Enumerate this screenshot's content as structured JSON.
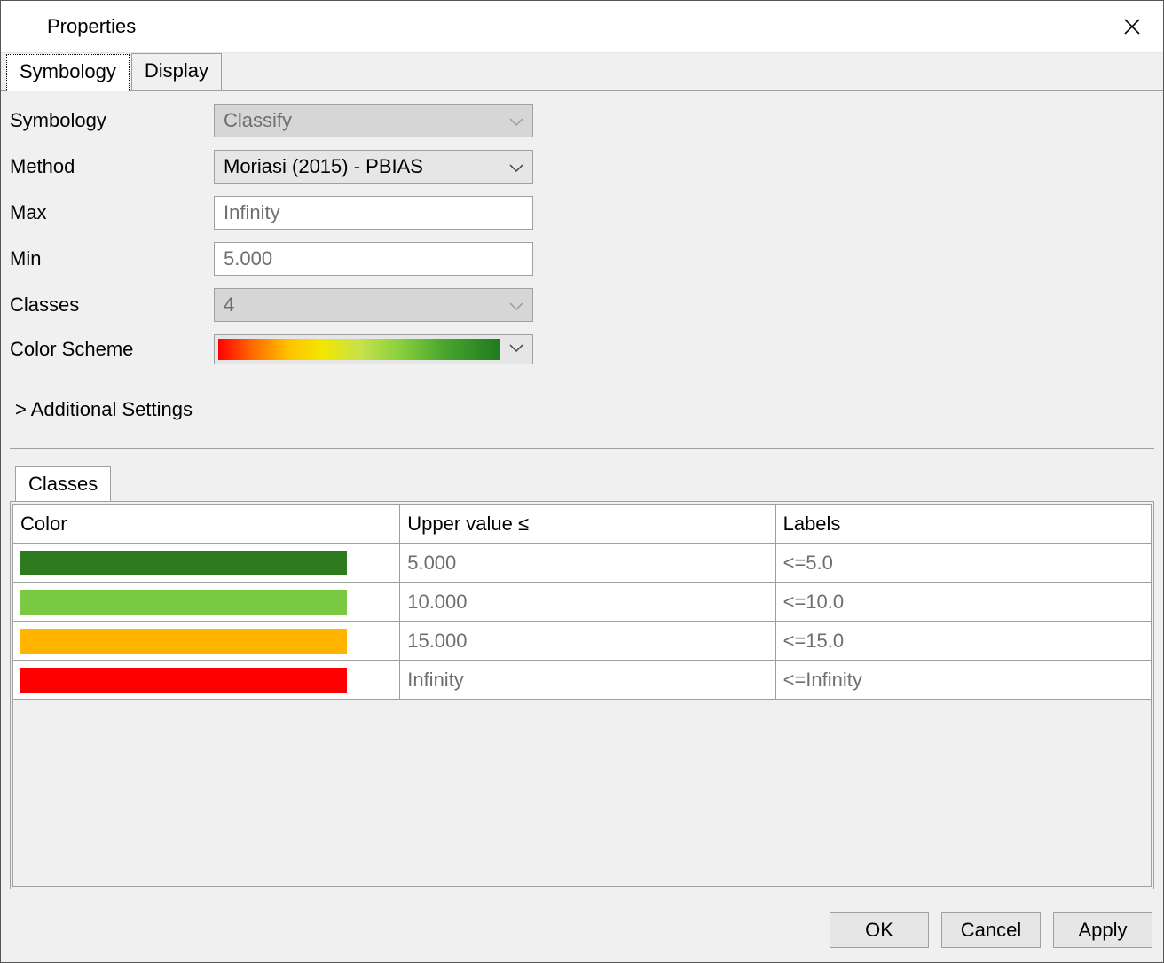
{
  "window": {
    "title": "Properties"
  },
  "tabs": {
    "symbology": "Symbology",
    "display": "Display"
  },
  "form": {
    "symbology_label": "Symbology",
    "symbology_value": "Classify",
    "method_label": "Method",
    "method_value": "Moriasi (2015) - PBIAS",
    "max_label": "Max",
    "max_value": "Infinity",
    "min_label": "Min",
    "min_value": "5.000",
    "classes_label": "Classes",
    "classes_value": "4",
    "colorscheme_label": "Color Scheme"
  },
  "expander": {
    "label": "> Additional Settings"
  },
  "subtabs": {
    "classes": "Classes"
  },
  "table": {
    "headers": {
      "color": "Color",
      "upper": "Upper value ≤",
      "labels": "Labels"
    },
    "rows": [
      {
        "color": "#2d7a1f",
        "upper": "5.000",
        "label": "<=5.0"
      },
      {
        "color": "#7ac943",
        "upper": "10.000",
        "label": "<=10.0"
      },
      {
        "color": "#ffb400",
        "upper": "15.000",
        "label": "<=15.0"
      },
      {
        "color": "#ff0000",
        "upper": "Infinity",
        "label": "<=Infinity"
      }
    ]
  },
  "buttons": {
    "ok": "OK",
    "cancel": "Cancel",
    "apply": "Apply"
  }
}
